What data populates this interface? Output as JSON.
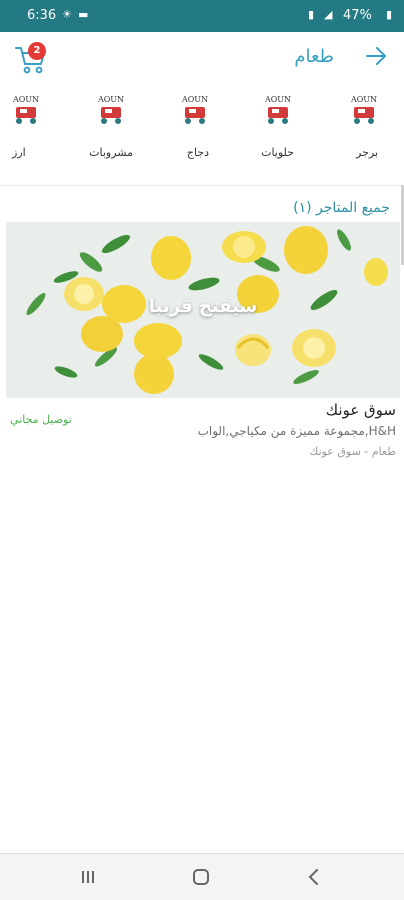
{
  "status_bar": {
    "time": "6:36",
    "battery": "47%"
  },
  "app_bar": {
    "title": "طعام",
    "cart_count": "2"
  },
  "categories": [
    {
      "logo_text": "AOUN",
      "label": "برجر"
    },
    {
      "logo_text": "AOUN",
      "label": "حلويات"
    },
    {
      "logo_text": "AOUN",
      "label": "دجاج"
    },
    {
      "logo_text": "AOUN",
      "label": "مشروبات"
    },
    {
      "logo_text": "AOUN",
      "label": "ارز"
    }
  ],
  "section": {
    "title": "جميع المتاجر (١)"
  },
  "store": {
    "banner_text": "سيفتح قريبا",
    "name": "سوق عونك",
    "description": "مجموعة مميزة من مكياجي,الواب,H&H",
    "meta": "طعام - سوق عونك",
    "delivery": "توصيل مجاني"
  },
  "colors": {
    "status_bar": "#237a85",
    "accent": "#3a9fc4",
    "badge": "#e53935",
    "free_delivery": "#4caf50"
  }
}
